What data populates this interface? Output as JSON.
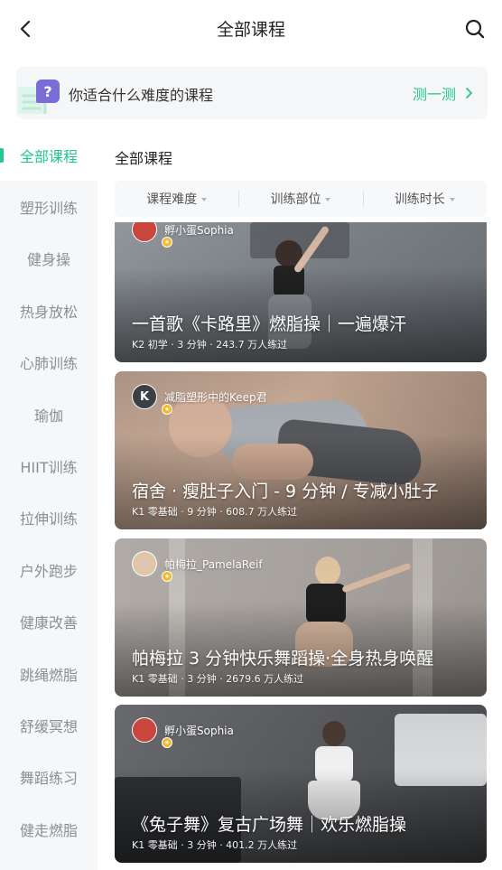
{
  "header": {
    "title": "全部课程"
  },
  "quiz": {
    "text": "你适合什么难度的课程",
    "action": "测一测",
    "badge": "?"
  },
  "sidebar": {
    "items": [
      {
        "label": "全部课程",
        "active": true
      },
      {
        "label": "塑形训练"
      },
      {
        "label": "健身操"
      },
      {
        "label": "热身放松"
      },
      {
        "label": "心肺训练"
      },
      {
        "label": "瑜伽"
      },
      {
        "label": "HIIT训练"
      },
      {
        "label": "拉伸训练"
      },
      {
        "label": "户外跑步"
      },
      {
        "label": "健康改善"
      },
      {
        "label": "跳绳燃脂"
      },
      {
        "label": "舒缓冥想"
      },
      {
        "label": "舞蹈练习"
      },
      {
        "label": "健走燃脂"
      }
    ]
  },
  "main": {
    "section_title": "全部课程",
    "filters": [
      {
        "label": "课程难度"
      },
      {
        "label": "训练部位"
      },
      {
        "label": "训练时长"
      }
    ],
    "courses": [
      {
        "author": "孵小蛋Sophia",
        "title": "一首歌《卡路里》燃脂操｜一遍爆汗",
        "meta": "K2 初学 · 3 分钟 · 243.7 万人练过",
        "avatar_letter": ""
      },
      {
        "author": "减脂塑形中的Keep君",
        "title": "宿舍 · 瘦肚子入门 - 9 分钟 / 专减小肚子",
        "meta": "K1 零基础 · 9 分钟 · 608.7 万人练过",
        "avatar_letter": "K"
      },
      {
        "author": "帕梅拉_PamelaReif",
        "title": "帕梅拉 3 分钟快乐舞蹈操·全身热身唤醒",
        "meta": "K1 零基础 · 3 分钟 · 2679.6 万人练过",
        "avatar_letter": ""
      },
      {
        "author": "孵小蛋Sophia",
        "title": "《兔子舞》复古广场舞｜欢乐燃脂操",
        "meta": "K1 零基础 · 3 分钟 · 401.2 万人练过",
        "avatar_letter": ""
      }
    ]
  },
  "colors": {
    "accent": "#24c789",
    "badge_purple": "#7b6cd6",
    "vip_gold": "#f4b82c"
  }
}
